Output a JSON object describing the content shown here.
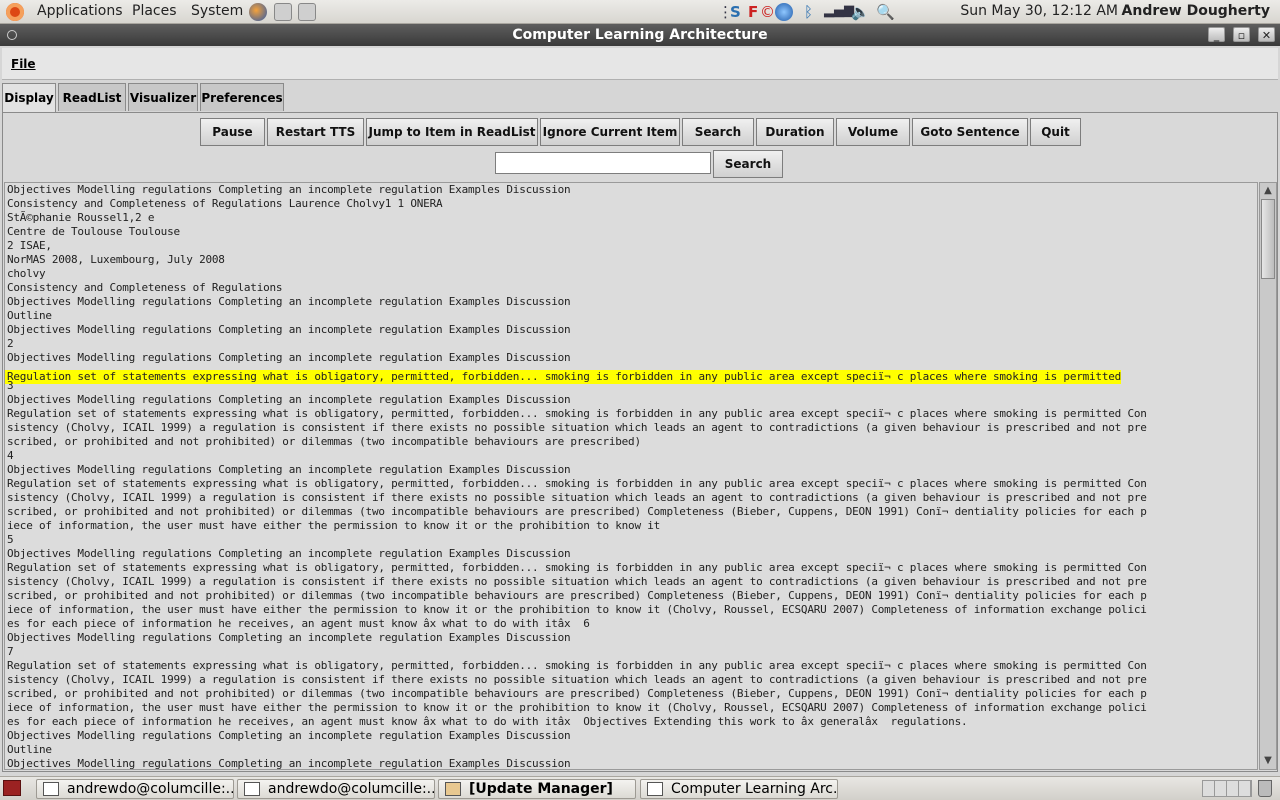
{
  "top_panel": {
    "menus": [
      "Applications",
      "Places",
      "System"
    ],
    "clock": "Sun May 30, 12:12 AM",
    "user": "Andrew Dougherty"
  },
  "window": {
    "title": "Computer Learning Architecture"
  },
  "menubar": {
    "file": "File"
  },
  "tabs": [
    {
      "label": "Display",
      "active": true
    },
    {
      "label": "ReadList"
    },
    {
      "label": "Visualizer"
    },
    {
      "label": "Preferences"
    }
  ],
  "toolbar": {
    "buttons": [
      "Pause",
      "Restart TTS",
      "Jump to Item in ReadList",
      "Ignore Current Item",
      "Search",
      "Duration",
      "Volume",
      "Goto Sentence",
      "Quit"
    ],
    "search_value": "",
    "search_button": "Search"
  },
  "text_lines": [
    "Objectives Modelling regulations Completing an incomplete regulation Examples Discussion",
    "Consistency and Completeness of Regulations Laurence Cholvy1 1 ONERA",
    "StÃ©phanie Roussel1,2 e",
    "Centre de Toulouse Toulouse",
    "2 ISAE,",
    "NorMAS 2008, Luxembourg, July 2008",
    "cholvy",
    "Consistency and Completeness of Regulations",
    "Objectives Modelling regulations Completing an incomplete regulation Examples Discussion",
    "Outline",
    "Objectives Modelling regulations Completing an incomplete regulation Examples Discussion",
    "2",
    "Objectives Modelling regulations Completing an incomplete regulation Examples Discussion",
    "Regulation set of statements expressing what is obligatory, permitted, forbidden... smoking is forbidden in any public area except speciï¬ c places where smoking is permitted",
    "3",
    "Objectives Modelling regulations Completing an incomplete regulation Examples Discussion",
    "Regulation set of statements expressing what is obligatory, permitted, forbidden... smoking is forbidden in any public area except speciï¬ c places where smoking is permitted Con",
    "sistency (Cholvy, ICAIL 1999) a regulation is consistent if there exists no possible situation which leads an agent to contradictions (a given behaviour is prescribed and not pre",
    "scribed, or prohibited and not prohibited) or dilemmas (two incompatible behaviours are prescribed)",
    "4",
    "Objectives Modelling regulations Completing an incomplete regulation Examples Discussion",
    "Regulation set of statements expressing what is obligatory, permitted, forbidden... smoking is forbidden in any public area except speciï¬ c places where smoking is permitted Con",
    "sistency (Cholvy, ICAIL 1999) a regulation is consistent if there exists no possible situation which leads an agent to contradictions (a given behaviour is prescribed and not pre",
    "scribed, or prohibited and not prohibited) or dilemmas (two incompatible behaviours are prescribed) Completeness (Bieber, Cuppens, DEON 1991) Conï¬ dentiality policies for each p",
    "iece of information, the user must have either the permission to know it or the prohibition to know it",
    "5",
    "Objectives Modelling regulations Completing an incomplete regulation Examples Discussion",
    "Regulation set of statements expressing what is obligatory, permitted, forbidden... smoking is forbidden in any public area except speciï¬ c places where smoking is permitted Con",
    "sistency (Cholvy, ICAIL 1999) a regulation is consistent if there exists no possible situation which leads an agent to contradictions (a given behaviour is prescribed and not pre",
    "scribed, or prohibited and not prohibited) or dilemmas (two incompatible behaviours are prescribed) Completeness (Bieber, Cuppens, DEON 1991) Conï¬ dentiality policies for each p",
    "iece of information, the user must have either the permission to know it or the prohibition to know it (Cholvy, Roussel, ECSQARU 2007) Completeness of information exchange polici",
    "es for each piece of information he receives, an agent must know âx what to do with itâx  6",
    "Objectives Modelling regulations Completing an incomplete regulation Examples Discussion",
    "7",
    "Regulation set of statements expressing what is obligatory, permitted, forbidden... smoking is forbidden in any public area except speciï¬ c places where smoking is permitted Con",
    "sistency (Cholvy, ICAIL 1999) a regulation is consistent if there exists no possible situation which leads an agent to contradictions (a given behaviour is prescribed and not pre",
    "scribed, or prohibited and not prohibited) or dilemmas (two incompatible behaviours are prescribed) Completeness (Bieber, Cuppens, DEON 1991) Conï¬ dentiality policies for each p",
    "iece of information, the user must have either the permission to know it or the prohibition to know it (Cholvy, Roussel, ECSQARU 2007) Completeness of information exchange polici",
    "es for each piece of information he receives, an agent must know âx what to do with itâx  Objectives Extending this work to âx generalâx  regulations.",
    "Objectives Modelling regulations Completing an incomplete regulation Examples Discussion",
    "Outline",
    "Objectives Modelling regulations Completing an incomplete regulation Examples Discussion"
  ],
  "highlighted_line": 13,
  "taskbar": {
    "tasks": [
      {
        "label": "andrewdo@columcille:...",
        "bold": false
      },
      {
        "label": "andrewdo@columcille:...",
        "bold": false
      },
      {
        "label": "[Update Manager]",
        "bold": true
      },
      {
        "label": "Computer Learning Arc...",
        "bold": false
      }
    ]
  },
  "colors": {
    "highlight": "#ffff00",
    "titlebar": "#3a3a3a"
  }
}
